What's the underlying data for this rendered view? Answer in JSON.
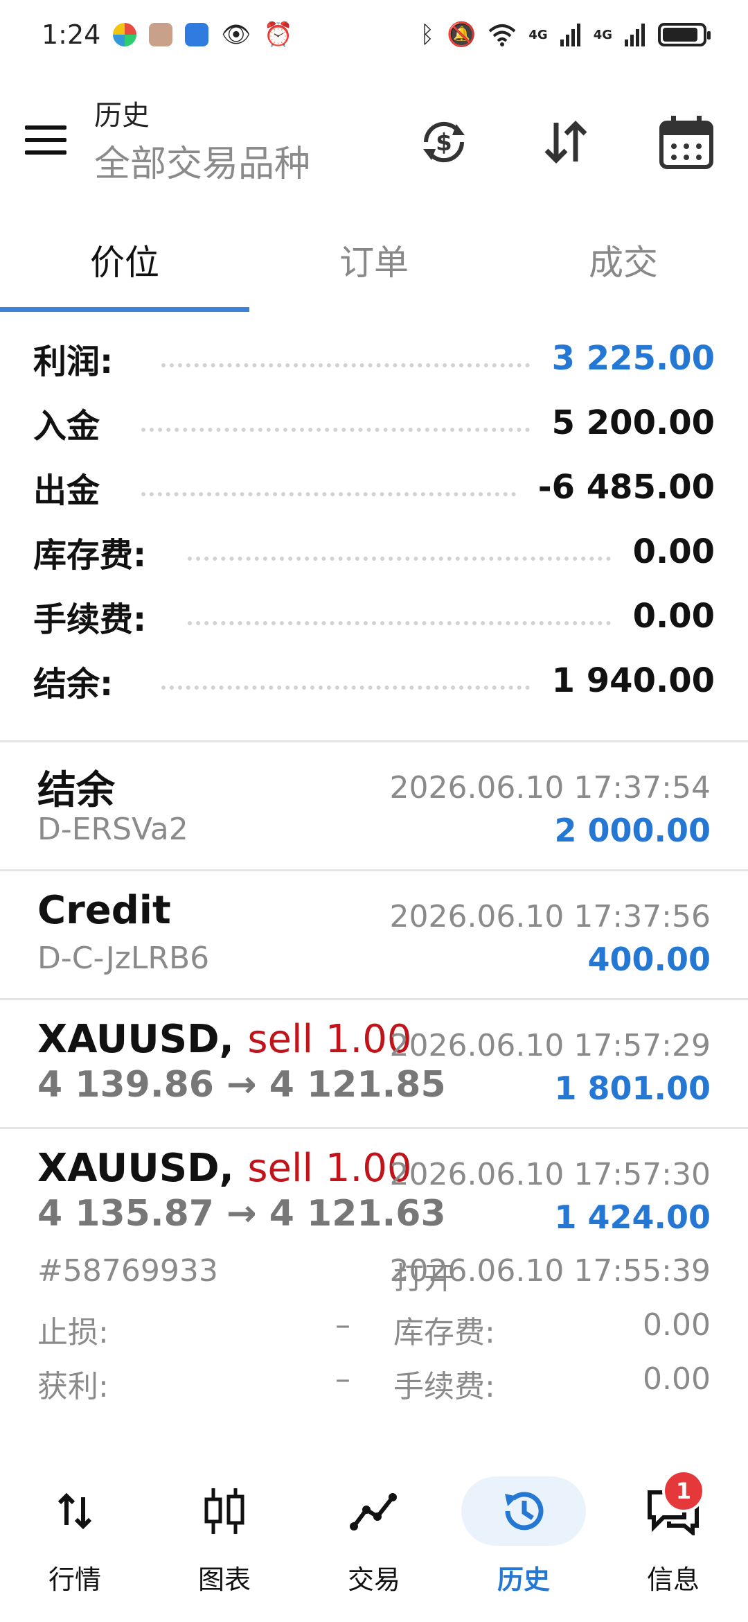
{
  "status_bar": {
    "time": "1:24",
    "network_labels": [
      "4G",
      "4G"
    ],
    "battery_level": 0.9
  },
  "app_bar": {
    "title": "历史",
    "subtitle": "全部交易品种",
    "icons": [
      "menu-icon",
      "currency-exchange-icon",
      "sort-icon",
      "calendar-icon"
    ]
  },
  "tabs": [
    {
      "label": "价位",
      "active": true
    },
    {
      "label": "订单",
      "active": false
    },
    {
      "label": "成交",
      "active": false
    }
  ],
  "summary": [
    {
      "label": "利润:",
      "value": "3 225.00",
      "highlight": true
    },
    {
      "label": "入金",
      "value": "5 200.00",
      "highlight": false
    },
    {
      "label": "出金",
      "value": "-6 485.00",
      "highlight": false
    },
    {
      "label": "库存费:",
      "value": "0.00",
      "highlight": false
    },
    {
      "label": "手续费:",
      "value": "0.00",
      "highlight": false
    },
    {
      "label": "结余:",
      "value": "1 940.00",
      "highlight": false
    }
  ],
  "deals": [
    {
      "title": "结余",
      "sub": "D-ERSVa2",
      "time": "2026.06.10 17:37:54",
      "amount": "2 000.00"
    },
    {
      "title": "Credit",
      "sub": "D-C-JzLRB6",
      "time": "2026.06.10 17:37:56",
      "amount": "400.00"
    },
    {
      "symbol": "XAUUSD,",
      "side": "sell 1.00",
      "prices": "4 139.86 → 4 121.85",
      "time": "2026.06.10 17:57:29",
      "amount": "1 801.00"
    },
    {
      "symbol": "XAUUSD,",
      "side": "sell 1.00",
      "prices": "4 135.87 → 4 121.63",
      "time": "2026.06.10 17:57:30",
      "amount": "1 424.00"
    }
  ],
  "deal_details": {
    "ticket": "#58769933",
    "open_label": "打开",
    "open_time": "2026.06.10 17:55:39",
    "sl_label": "止损:",
    "sl_value": "–",
    "swap_label": "库存费:",
    "swap_value": "0.00",
    "tp_label": "获利:",
    "tp_value": "–",
    "commission_label": "手续费:",
    "commission_value": "0.00"
  },
  "bottom_nav": [
    {
      "label": "行情",
      "icon": "quotes-arrows-icon",
      "active": false
    },
    {
      "label": "图表",
      "icon": "candlestick-chart-icon",
      "active": false
    },
    {
      "label": "交易",
      "icon": "trade-line-icon",
      "active": false
    },
    {
      "label": "历史",
      "icon": "history-clock-icon",
      "active": true
    },
    {
      "label": "信息",
      "icon": "messages-icon",
      "active": false,
      "badge": "1"
    }
  ],
  "colors": {
    "accent": "#2478d4",
    "sell": "#c0141a",
    "badge": "#e5383b",
    "muted": "#8a8a8a"
  }
}
